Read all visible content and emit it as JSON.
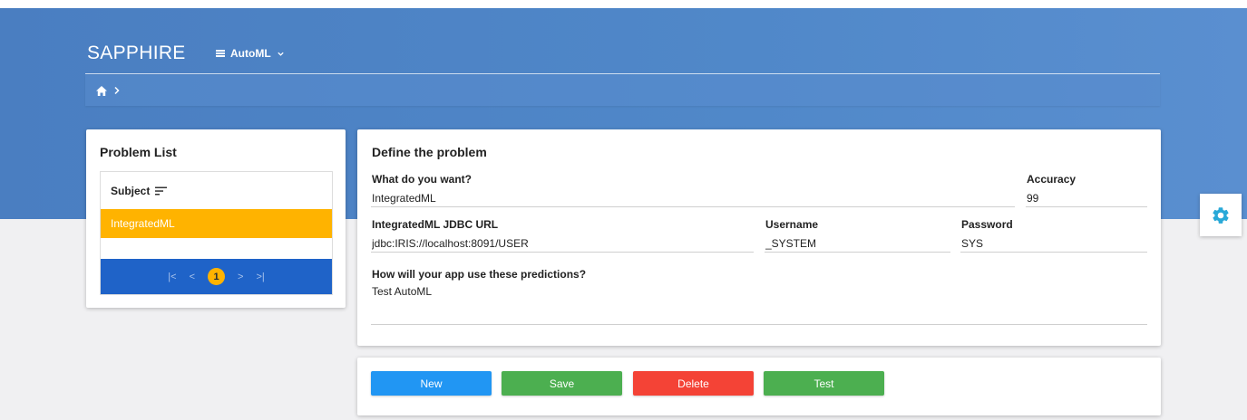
{
  "app": {
    "brand": "SAPPHIRE",
    "menu_label": "AutoML"
  },
  "problem_list": {
    "title": "Problem List",
    "column_header": "Subject",
    "rows": [
      "IntegratedML"
    ],
    "current_page": "1",
    "pager": {
      "first": "|<",
      "prev": "<",
      "next": ">",
      "last": ">|"
    }
  },
  "definition": {
    "title": "Define the problem",
    "want_label": "What do you want?",
    "want_value": "IntegratedML",
    "accuracy_label": "Accuracy",
    "accuracy_value": "99",
    "jdbc_label": "IntegratedML JDBC URL",
    "jdbc_value": "jdbc:IRIS://localhost:8091/USER",
    "username_label": "Username",
    "username_value": "_SYSTEM",
    "password_label": "Password",
    "password_value": "SYS",
    "usage_label": "How will your app use these predictions?",
    "usage_value": "Test AutoML"
  },
  "actions": {
    "new": "New",
    "save": "Save",
    "delete": "Delete",
    "test": "Test"
  },
  "colors": {
    "header_blue": "#4a7ec1",
    "selected_row": "#ffb300",
    "pager_blue": "#1f63c8",
    "new_button": "#2196f3",
    "save_button": "#4caf50",
    "delete_button": "#f44336",
    "test_button": "#4caf50",
    "gear": "#29a9d8"
  },
  "icons": {
    "breadcrumb_home": "home-icon",
    "breadcrumb_sep": "chevron-right-icon",
    "settings": "gear-icon",
    "sort": "sort-icon",
    "menu": "list-icon",
    "menu_caret": "chevron-down-icon"
  }
}
